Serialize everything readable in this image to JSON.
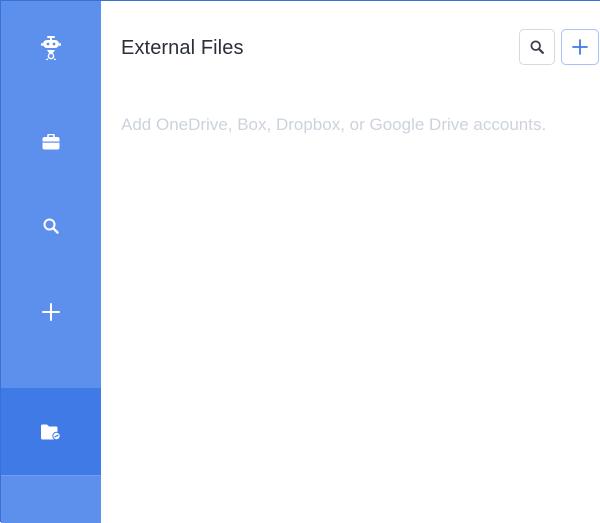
{
  "app": {
    "accent_color": "#5d8fed",
    "active_color": "#3f7ae6"
  },
  "sidebar": {
    "items": [
      {
        "id": "logo",
        "icon": "robot-logo-icon",
        "active": false
      },
      {
        "id": "briefcase",
        "icon": "briefcase-icon",
        "active": false
      },
      {
        "id": "search",
        "icon": "search-icon",
        "active": false
      },
      {
        "id": "add",
        "icon": "plus-icon",
        "active": false
      },
      {
        "id": "external-files",
        "icon": "folder-link-icon",
        "active": true
      }
    ]
  },
  "header": {
    "title": "External Files",
    "search_icon": "search-icon",
    "add_icon": "plus-icon"
  },
  "main": {
    "empty_message": "Add OneDrive, Box, Dropbox, or Google Drive accounts."
  }
}
